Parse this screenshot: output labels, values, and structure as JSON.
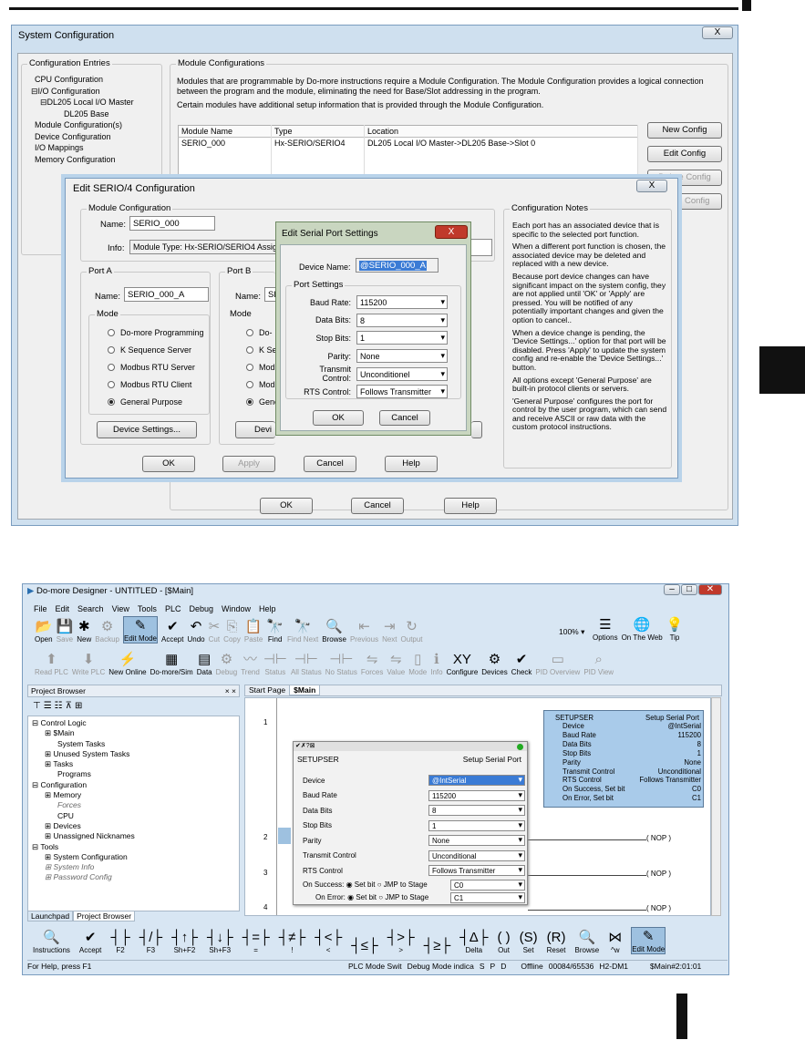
{
  "sysconfig": {
    "title": "System Configuration",
    "close": "X",
    "entries_title": "Configuration Entries",
    "tree": [
      "CPU Configuration",
      "I/O Configuration",
      "DL205 Local I/O Master",
      "DL205 Base",
      "Module Configuration(s)",
      "Device Configuration",
      "I/O Mappings",
      "Memory Configuration"
    ],
    "module_title": "Module Configurations",
    "desc1": "Modules that are programmable by Do-more instructions require a Module Configuration. The Module Configuration provides a logical connection between the program and the module, eliminating the need for Base/Slot addressing in the program.",
    "desc2": "Certain modules have additional setup information that is provided through the Module Configuration.",
    "table": {
      "headers": [
        "Module Name",
        "Type",
        "Location"
      ],
      "rows": [
        [
          "SERIO_000",
          "Hx-SERIO/SERIO4",
          "DL205 Local I/O Master->DL205 Base->Slot 0"
        ]
      ]
    },
    "buttons": [
      "New Config",
      "Edit Config",
      "Delete Config",
      "Clean Config"
    ],
    "ok": "OK",
    "cancel": "Cancel",
    "help": "Help"
  },
  "edit": {
    "title": "Edit SERIO/4 Configuration",
    "close": "X",
    "modcfg": "Module Configuration",
    "name_label": "Name:",
    "name": "SERIO_000",
    "info_label": "Info:",
    "info": "Module Type: Hx-SERIO/SERIO4  Assig",
    "portA": "Port A",
    "portB": "Port B",
    "portA_name": "SERIO_000_A",
    "portB_name": "SE",
    "mode": "Mode",
    "modes": [
      "Do-more Programming",
      "K Sequence Server",
      "Modbus RTU Server",
      "Modbus RTU Client",
      "General Purpose"
    ],
    "portB_modes": [
      "Do-",
      "K Se",
      "Modb",
      "Modb",
      "Gene"
    ],
    "device_settings": "Device Settings...",
    "device_settings_b": "Devi",
    "notes_title": "Configuration Notes",
    "notes": [
      "Each port has an associated device that is specific to the selected port function.",
      "When a different port function is chosen, the associated device may be deleted and replaced with a new device.",
      "Because port device changes can have significant impact on the system config, they are not applied until 'OK' or 'Apply' are pressed. You will be notified of any potentially important changes and given the option to cancel..",
      "When a device change is pending, the 'Device Settings...' option for that port will be disabled. Press 'Apply' to update the system config and re-enable the 'Device Settings...' button.",
      "All options except 'General Purpose' are built-in protocol clients or servers.",
      "'General Purpose' configures the port for control by the user program, which can send and receive ASCII or raw data with the custom protocol instructions."
    ],
    "ok": "OK",
    "apply": "Apply",
    "cancel": "Cancel",
    "help": "Help"
  },
  "sps": {
    "title": "Edit Serial Port Settings",
    "close": "X",
    "device_label": "Device Name:",
    "device": "@SERIO_000_A",
    "group": "Port Settings",
    "fields": [
      [
        "Baud Rate:",
        "115200"
      ],
      [
        "Data Bits:",
        "8"
      ],
      [
        "Stop Bits:",
        "1"
      ],
      [
        "Parity:",
        "None"
      ],
      [
        "Transmit Control:",
        "Unconditionel"
      ],
      [
        "RTS Control:",
        "Follows Transmitter"
      ]
    ],
    "ok": "OK",
    "cancel": "Cancel"
  },
  "designer": {
    "title": "Do-more Designer - UNTITLED - [$Main]",
    "menu": [
      "File",
      "Edit",
      "Search",
      "View",
      "Tools",
      "PLC",
      "Debug",
      "Window",
      "Help"
    ],
    "tb1": [
      [
        "Open",
        "📂"
      ],
      [
        "Save",
        "💾"
      ],
      [
        "New",
        "✱"
      ],
      [
        "Backup",
        "⚙"
      ],
      [
        "Edit Mode",
        "✎"
      ],
      [
        "Accept",
        "✔"
      ],
      [
        "Undo",
        "↶"
      ],
      [
        "Cut",
        "✂"
      ],
      [
        "Copy",
        "⎘"
      ],
      [
        "Paste",
        "📋"
      ],
      [
        "Find",
        "🔭"
      ],
      [
        "Find Next",
        "🔭"
      ],
      [
        "Browse",
        "🔍"
      ],
      [
        "Previous",
        "⇤"
      ],
      [
        "Next",
        "⇥"
      ],
      [
        "Output",
        "↻"
      ]
    ],
    "zoom": "100%",
    "tb1b": [
      [
        "Options",
        "☰"
      ],
      [
        "On The Web",
        "🌐"
      ],
      [
        "Tip",
        "💡"
      ]
    ],
    "tb2": [
      [
        "Read PLC",
        "⬆"
      ],
      [
        "Write PLC",
        "⬇"
      ],
      [
        "New Online",
        "⚡"
      ],
      [
        "Do-more/Sim",
        "▦"
      ],
      [
        "Data",
        "▤"
      ],
      [
        "Debug",
        "⚙"
      ],
      [
        "Trend",
        "〰"
      ],
      [
        "Status",
        "⊣⊢"
      ],
      [
        "All Status",
        "⊣⊢"
      ],
      [
        "No Status",
        "⊣⊢"
      ],
      [
        "Forces",
        "⇋"
      ],
      [
        "Value",
        "⇋"
      ],
      [
        "Mode",
        "▯"
      ],
      [
        "Info",
        "ℹ"
      ],
      [
        "Configure",
        "XY"
      ],
      [
        "Devices",
        "⚙"
      ],
      [
        "Check",
        "✔"
      ],
      [
        "PID Overview",
        "▭"
      ],
      [
        "PID View",
        "⌕"
      ]
    ],
    "project_browser": "Project Browser",
    "pb_close": "× ×",
    "tree": [
      [
        "Control Logic",
        0
      ],
      [
        "$Main",
        1
      ],
      [
        "System Tasks",
        2
      ],
      [
        "Unused System Tasks",
        1
      ],
      [
        "Tasks",
        1
      ],
      [
        "Programs",
        2
      ],
      [
        "Configuration",
        0
      ],
      [
        "Memory",
        1
      ],
      [
        "Forces",
        2
      ],
      [
        "CPU",
        2
      ],
      [
        "Devices",
        1
      ],
      [
        "Unassigned Nicknames",
        1
      ],
      [
        "Tools",
        0
      ],
      [
        "System Configuration",
        1
      ],
      [
        "System Info",
        1
      ],
      [
        "Password Config",
        1
      ]
    ],
    "tab_launchpad": "Launchpad",
    "tab_pb": "Project Browser",
    "tabs": [
      "Start Page",
      "$Main"
    ],
    "rungs": [
      "1",
      "2",
      "3",
      "4"
    ],
    "nop": "NOP",
    "setupser": {
      "title": "SETUPSER",
      "subtitle": "Setup Serial Port",
      "rows": [
        [
          "Device",
          "@IntSerial"
        ],
        [
          "Baud Rate",
          "115200"
        ],
        [
          "Data Bits",
          "8"
        ],
        [
          "Stop Bits",
          "1"
        ],
        [
          "Parity",
          "None"
        ],
        [
          "Transmit Control",
          "Unconditional"
        ],
        [
          "RTS Control",
          "Follows Transmitter"
        ]
      ],
      "on_success": "On Success:",
      "on_error": "On Error:",
      "set_bit": "Set bit",
      "jmp": "JMP to Stage",
      "c0": "C0",
      "c1": "C1"
    },
    "summary": {
      "title": "SETUPSER",
      "subtitle": "Setup Serial Port",
      "rows": [
        [
          "Device",
          "@IntSerial"
        ],
        [
          "Baud Rate",
          "115200"
        ],
        [
          "Data Bits",
          "8"
        ],
        [
          "Stop Bits",
          "1"
        ],
        [
          "Parity",
          "None"
        ],
        [
          "Transmit Control",
          "Unconditional"
        ],
        [
          "RTS Control",
          "Follows Transmitter"
        ],
        [
          "On Success, Set bit",
          "C0"
        ],
        [
          "On Error, Set bit",
          "C1"
        ]
      ]
    },
    "bottom": [
      [
        "Instructions",
        "🔍"
      ],
      [
        "Accept",
        "✔"
      ],
      [
        "F2",
        "┤├"
      ],
      [
        "F3",
        "┤/├"
      ],
      [
        "Sh+F2",
        "┤↑├"
      ],
      [
        "Sh+F3",
        "┤↓├"
      ],
      [
        "=",
        "┤=├"
      ],
      [
        "!",
        "┤≠├"
      ],
      [
        "<",
        "┤<├"
      ],
      [
        "",
        "┤≤├"
      ],
      [
        ">",
        "┤>├"
      ],
      [
        "",
        "┤≥├"
      ],
      [
        "Delta",
        "┤Δ├"
      ],
      [
        "Out",
        "( )"
      ],
      [
        "Set",
        "(S)"
      ],
      [
        "Reset",
        "(R)"
      ],
      [
        "Browse",
        "🔍"
      ],
      [
        "^w",
        "⋈"
      ],
      [
        "Edit Mode",
        "✎"
      ]
    ],
    "status": [
      "For Help, press F1",
      "PLC Mode Swit",
      "Debug Mode indica",
      "S",
      "P",
      "D",
      "Offline",
      "00084/65536",
      "H2-DM1",
      "$Main#2:01:01"
    ]
  }
}
